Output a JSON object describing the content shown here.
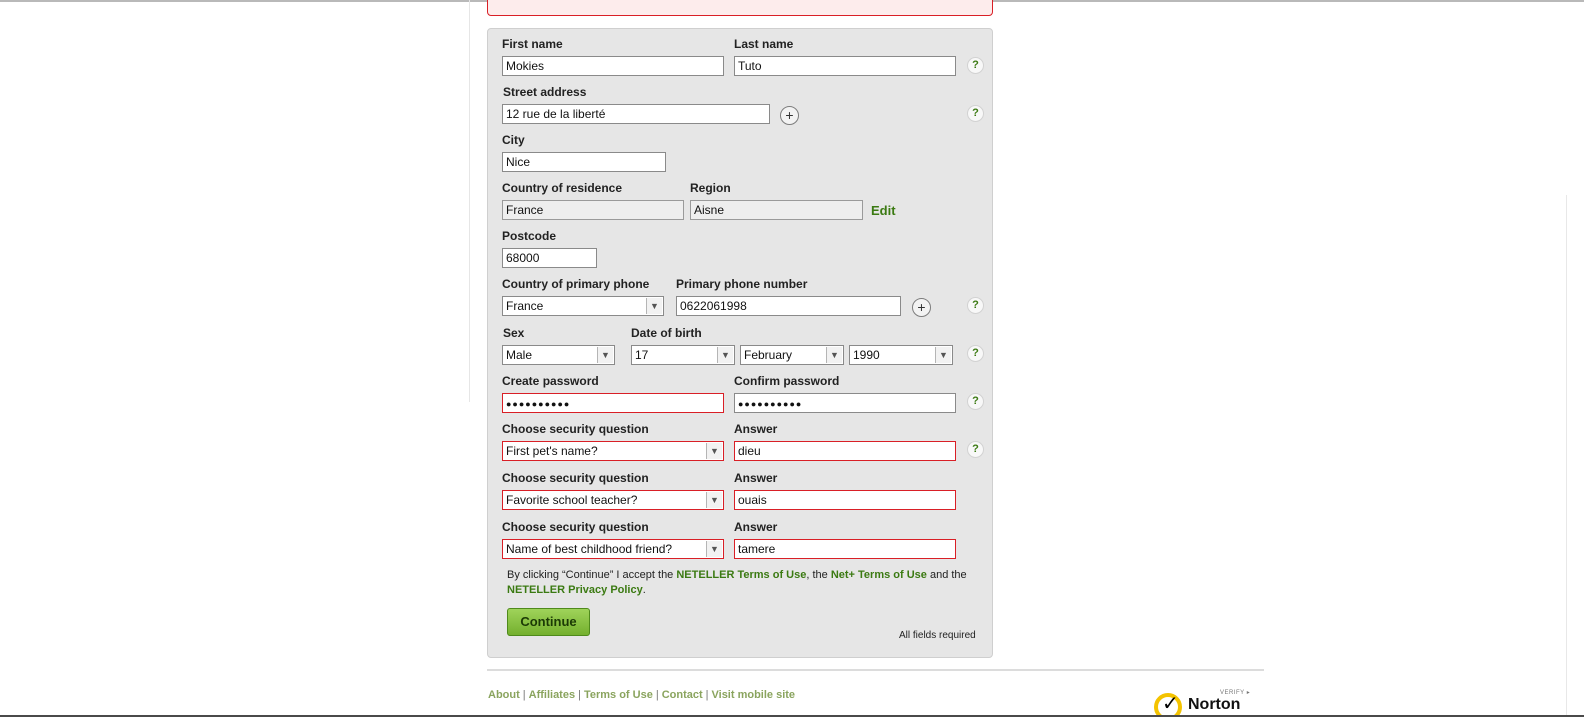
{
  "form": {
    "first_name_label": "First name",
    "first_name_value": "Mokies",
    "last_name_label": "Last name",
    "last_name_value": "Tuto",
    "street_label": "Street address",
    "street_value": "12 rue de la liberté",
    "city_label": "City",
    "city_value": "Nice",
    "country_label": "Country of residence",
    "country_value": "France",
    "region_label": "Region",
    "region_value": "Aisne",
    "edit_label": "Edit",
    "postcode_label": "Postcode",
    "postcode_value": "68000",
    "phone_country_label": "Country of primary phone",
    "phone_country_value": "France",
    "phone_label": "Primary phone number",
    "phone_value": "0622061998",
    "sex_label": "Sex",
    "sex_value": "Male",
    "dob_label": "Date of birth",
    "dob_day": "17",
    "dob_month": "February",
    "dob_year": "1990",
    "create_pw_label": "Create password",
    "create_pw_value": "●●●●●●●●●●",
    "confirm_pw_label": "Confirm password",
    "confirm_pw_value": "●●●●●●●●●●",
    "security_question_label": "Choose security question",
    "answer_label": "Answer",
    "security": [
      {
        "question": "First pet's name?",
        "answer": "dieu"
      },
      {
        "question": "Favorite school teacher?",
        "answer": "ouais"
      },
      {
        "question": "Name of best childhood friend?",
        "answer": "tamere"
      }
    ],
    "help_glyph": "?",
    "plus_glyph": "+",
    "arrow_glyph": "▼"
  },
  "terms": {
    "prefix": "By clicking “Continue” I accept the ",
    "tou_link": "NETELLER Terms of Use",
    "mid1": ", the ",
    "netplus_link": "Net+ Terms of Use",
    "mid2": " and the ",
    "privacy_link": "NETELLER Privacy Policy",
    "suffix": "."
  },
  "continue_label": "Continue",
  "required_note": "All fields required",
  "footer": {
    "links": [
      "About",
      "Affiliates",
      "Terms of Use",
      "Contact",
      "Visit mobile site"
    ],
    "separator": "|"
  },
  "norton": {
    "verify": "VERIFY ▸",
    "word": "Norton",
    "colors": {
      "ring": "#f4c300"
    }
  },
  "colors": {
    "accent_green": "#3b7a12",
    "error_red": "#d91f26",
    "panel_gray": "#e6e6e6",
    "button_green": "#74b02e"
  }
}
